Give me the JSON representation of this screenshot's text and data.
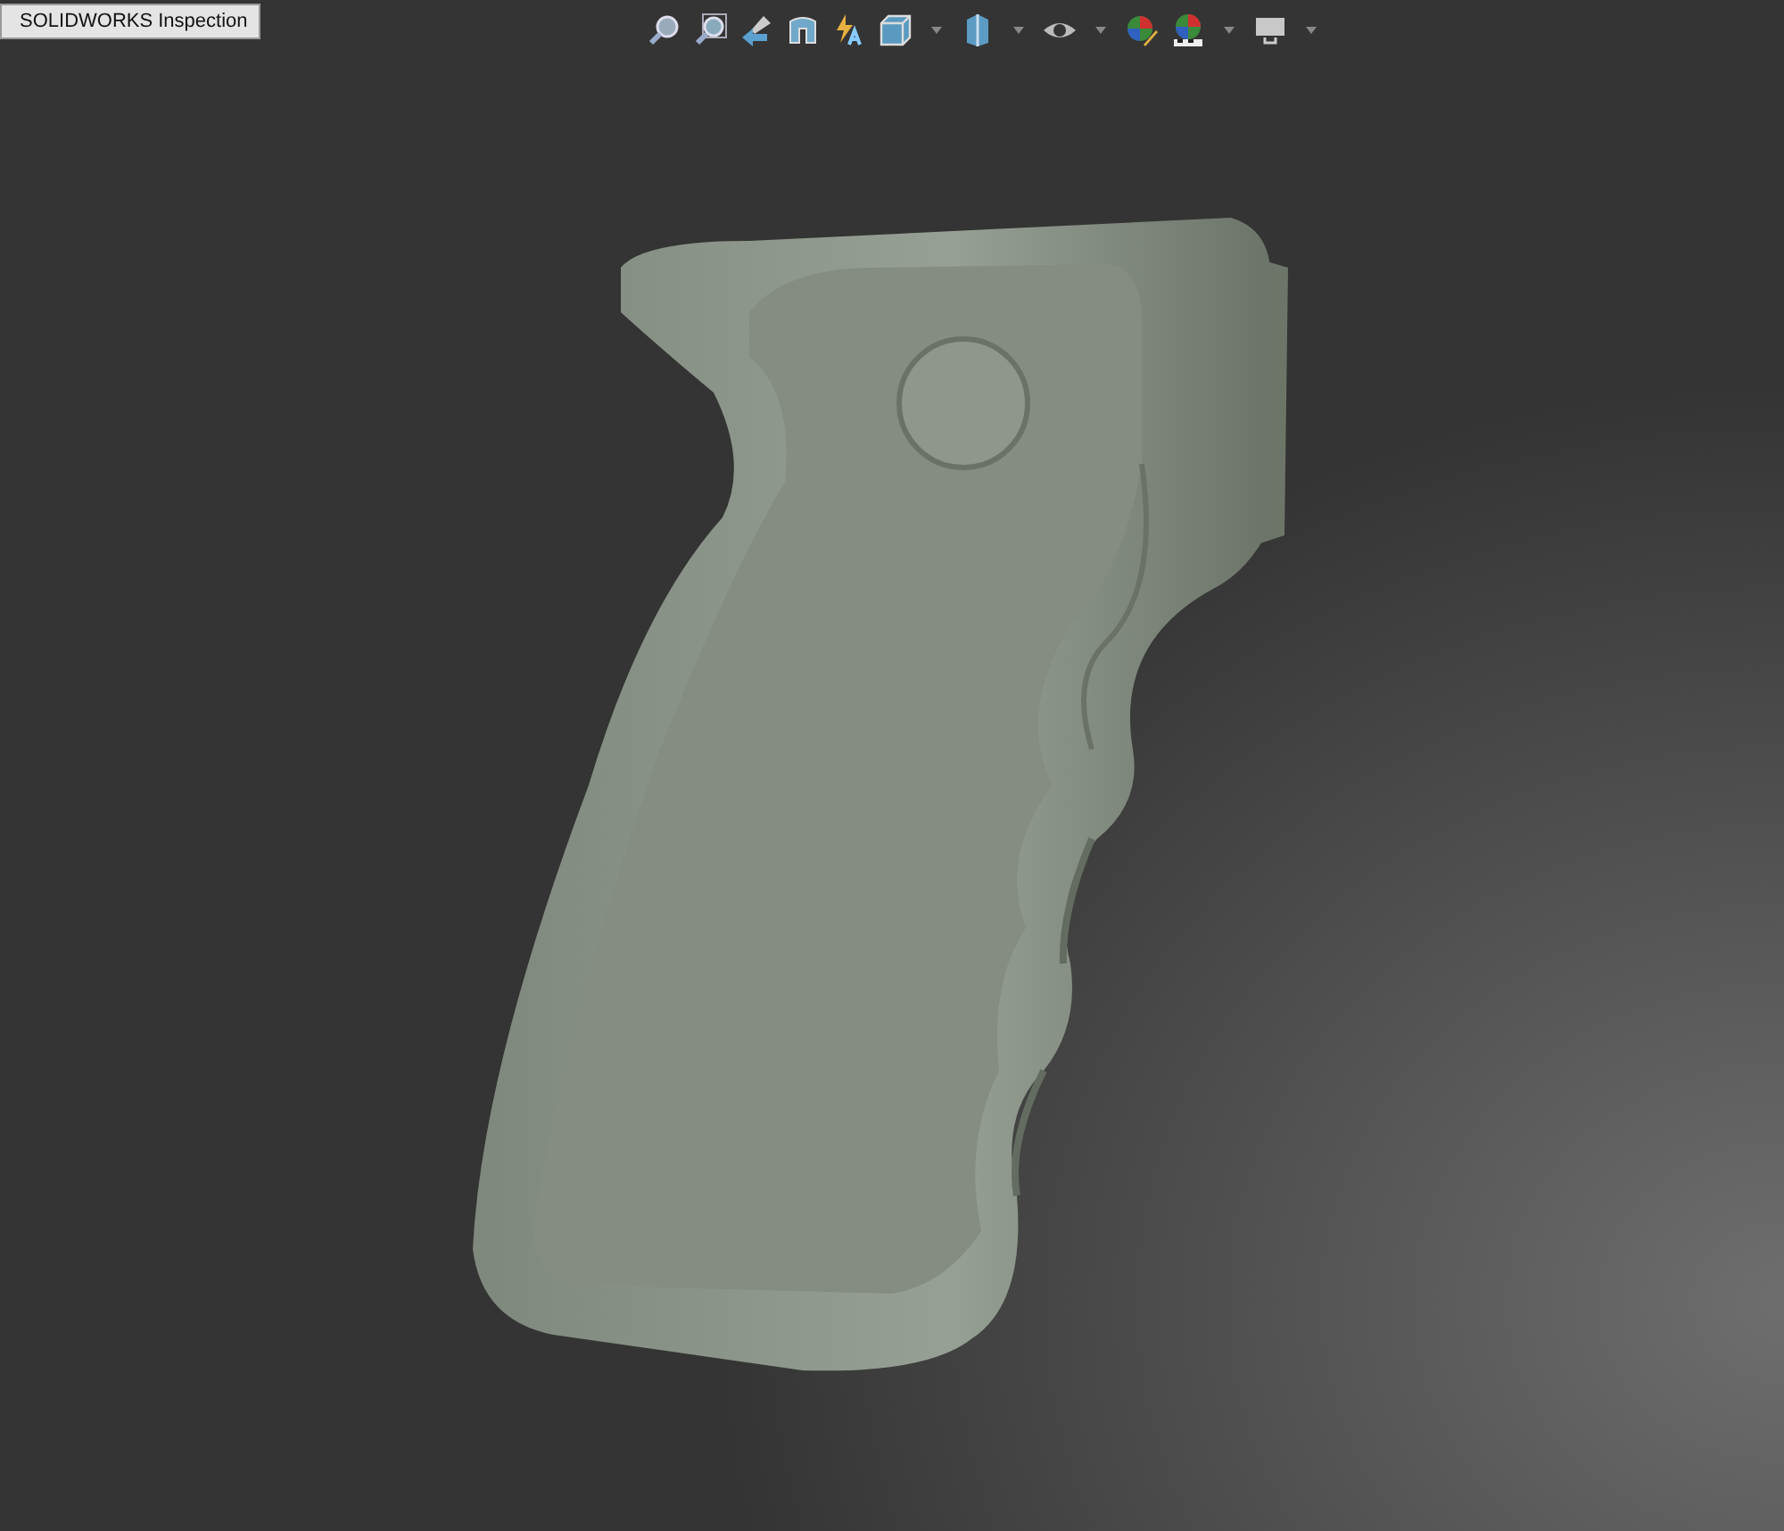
{
  "window": {
    "title": "SOLIDWORKS Inspection"
  }
}
